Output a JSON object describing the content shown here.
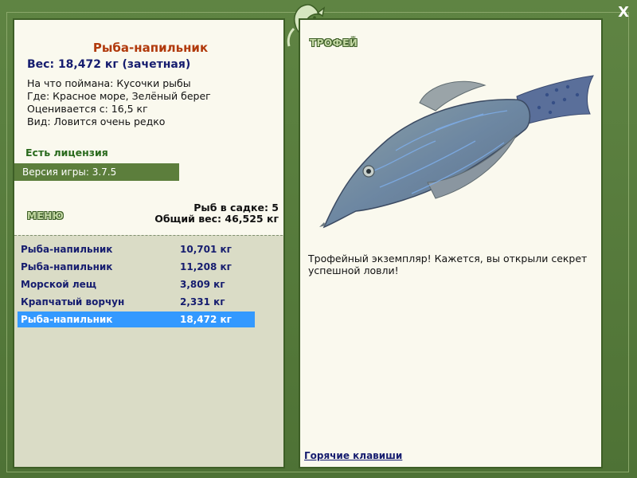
{
  "window": {
    "close_label": "X"
  },
  "fish": {
    "title": "Рыба-напильник",
    "weight": "Вес: 18,472 кг (зачетная)",
    "details": [
      "На что поймана: Кусочки рыбы",
      "Где: Красное море, Зелёный берег",
      "Оценивается с: 16,5 кг",
      "Вид: Ловится очень редко"
    ],
    "license": "Есть лицензия",
    "version": "Версия игры: 3.7.5"
  },
  "menu": {
    "label": "МЕНЮ"
  },
  "keep": {
    "count": "Рыб в садке: 5",
    "total": "Общий вес: 46,525 кг"
  },
  "catch_list": [
    {
      "name": "Рыба-напильник",
      "weight": "10,701 кг",
      "selected": false
    },
    {
      "name": "Рыба-напильник",
      "weight": "11,208 кг",
      "selected": false
    },
    {
      "name": "Морской лещ",
      "weight": "3,809 кг",
      "selected": false
    },
    {
      "name": "Крапчатый ворчун",
      "weight": "2,331 кг",
      "selected": false
    },
    {
      "name": "Рыба-напильник",
      "weight": "18,472 кг",
      "selected": true
    }
  ],
  "trophy": {
    "label": "ТРОФЕЙ",
    "text": "Трофейный экземпляр! Кажется, вы открыли секрет успешной ловли!"
  },
  "footer": {
    "hotkeys": "Горячие клавиши"
  },
  "colors": {
    "frame": "#55783a",
    "panel": "#faf9ee",
    "list_bg": "#dadcc6",
    "selection": "#3399ff",
    "title": "#b13a0c",
    "navy": "#161d6f"
  }
}
